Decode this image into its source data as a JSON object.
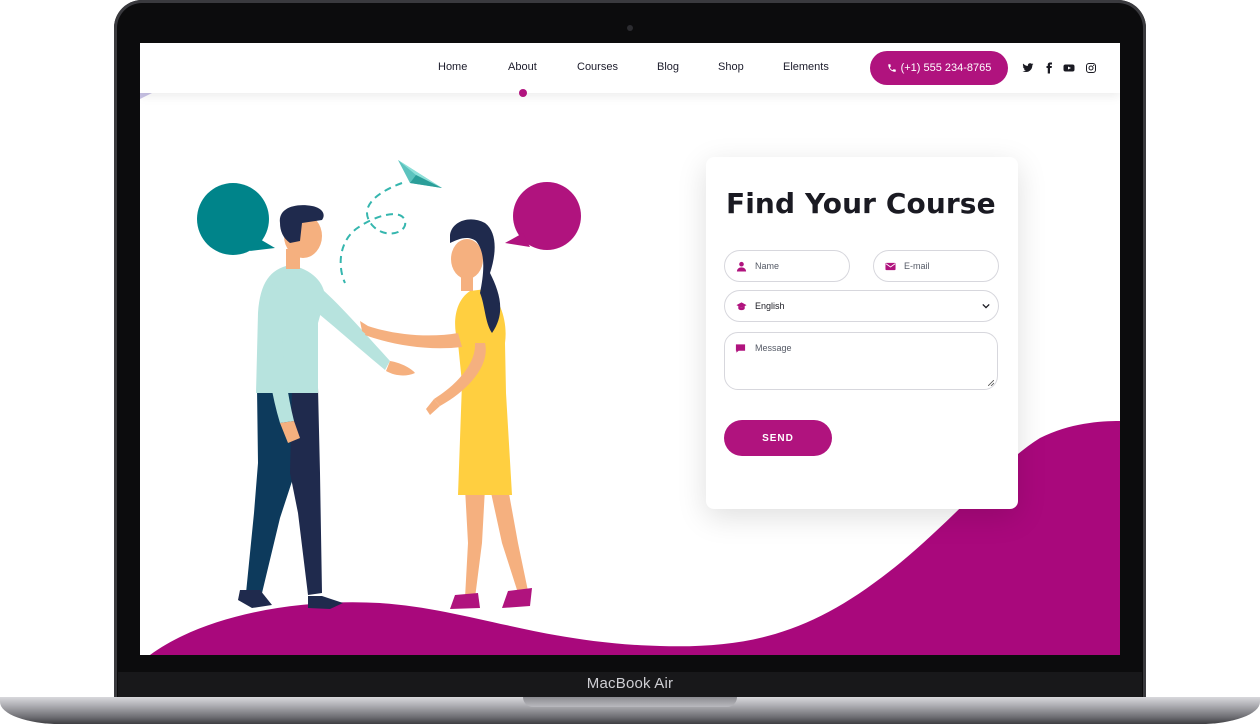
{
  "device": {
    "label": "MacBook Air"
  },
  "nav": {
    "links": [
      "Home",
      "About",
      "Courses",
      "Blog",
      "Shop",
      "Elements"
    ],
    "active": "About",
    "phone": "(+1) 555 234-8765",
    "social_icons": [
      "twitter-icon",
      "facebook-icon",
      "youtube-icon",
      "instagram-icon"
    ]
  },
  "form": {
    "title": "Find Your Course",
    "name_placeholder": "Name",
    "email_placeholder": "E-mail",
    "course_selected": "English",
    "message_placeholder": "Message",
    "send_label": "SEND"
  },
  "colors": {
    "accent": "#b0137e",
    "wave": "#a9087c",
    "teal": "#00848a",
    "dark_text": "#1a1a22"
  }
}
